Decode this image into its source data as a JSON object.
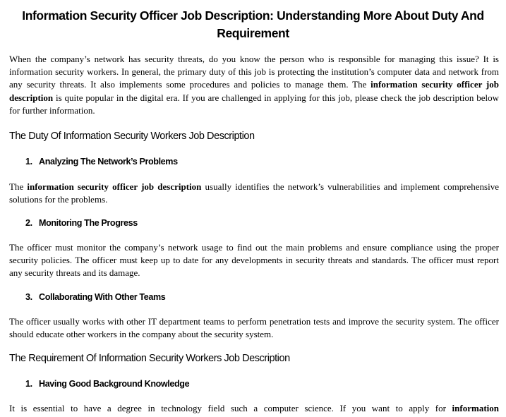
{
  "document": {
    "title": "Information Security Officer Job Description: Understanding More About Duty And Requirement",
    "intro": {
      "before_bold": "When the company’s network has security threats, do you know the person who is responsible for managing this issue? It is information security workers. In general, the primary duty of this job is protecting the institution’s computer data and network from any security threats. It also implements some procedures and policies to manage them. The ",
      "bold": "information security officer job description",
      "after_bold": " is quite popular in the digital era. If you are challenged in applying for this job, please check the job description below for further information."
    },
    "sections": [
      {
        "heading": "The Duty Of Information Security Workers Job Description",
        "items": [
          {
            "number": "1.",
            "title": "Analyzing The Network’s Problems",
            "text_before_bold": "The ",
            "text_bold": "information security officer job description",
            "text_after_bold": " usually identifies the network’s vulnerabilities and implement comprehensive solutions for the problems."
          },
          {
            "number": "2.",
            "title": "Monitoring The Progress",
            "text": "The officer must monitor the company’s network usage to find out the main problems and ensure compliance using the proper security policies. The officer must keep up to date for any developments in security threats and standards. The officer must report any security threats and its damage."
          },
          {
            "number": "3.",
            "title": "Collaborating With Other Teams",
            "text": "The officer usually works with other IT department teams to perform penetration tests and improve the security system. The officer should educate other workers in the company about the security system."
          }
        ]
      },
      {
        "heading": "The Requirement Of Information Security Workers Job Description",
        "items": [
          {
            "number": "1.",
            "title": "Having Good Background Knowledge",
            "text_before_bold": "It is essential to have a degree in technology field such a computer science. If you want to apply for ",
            "text_bold": "information"
          }
        ]
      }
    ]
  }
}
